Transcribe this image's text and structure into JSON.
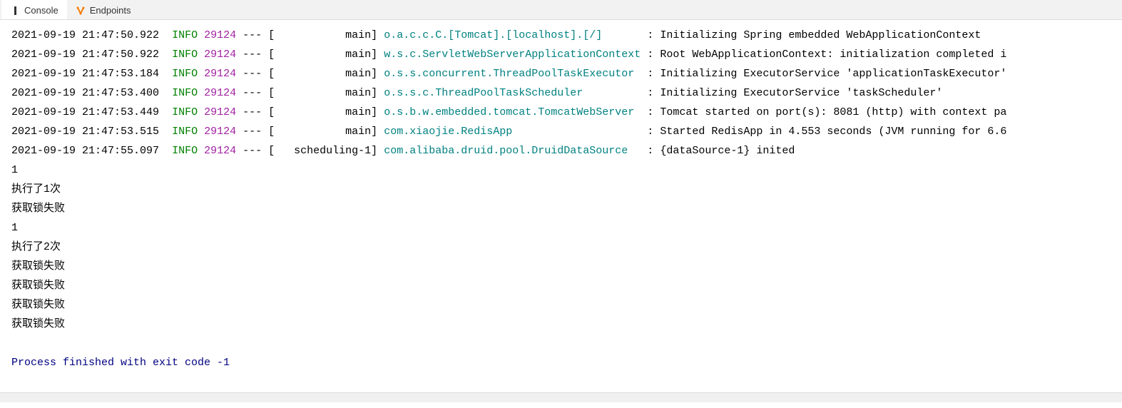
{
  "tabs": {
    "console": "Console",
    "endpoints": "Endpoints"
  },
  "lines": [
    {
      "type": "log",
      "timestamp": "2021-09-19 21:47:50.922",
      "level": "INFO",
      "pid": "29124",
      "dash": "---",
      "thread": "[           main]",
      "logger": "o.a.c.c.C.[Tomcat].[localhost].[/]      ",
      "message": "Initializing Spring embedded WebApplicationContext"
    },
    {
      "type": "log",
      "timestamp": "2021-09-19 21:47:50.922",
      "level": "INFO",
      "pid": "29124",
      "dash": "---",
      "thread": "[           main]",
      "logger": "w.s.c.ServletWebServerApplicationContext",
      "message": "Root WebApplicationContext: initialization completed i"
    },
    {
      "type": "log",
      "timestamp": "2021-09-19 21:47:53.184",
      "level": "INFO",
      "pid": "29124",
      "dash": "---",
      "thread": "[           main]",
      "logger": "o.s.s.concurrent.ThreadPoolTaskExecutor ",
      "message": "Initializing ExecutorService 'applicationTaskExecutor'"
    },
    {
      "type": "log",
      "timestamp": "2021-09-19 21:47:53.400",
      "level": "INFO",
      "pid": "29124",
      "dash": "---",
      "thread": "[           main]",
      "logger": "o.s.s.c.ThreadPoolTaskScheduler         ",
      "message": "Initializing ExecutorService 'taskScheduler'"
    },
    {
      "type": "log",
      "timestamp": "2021-09-19 21:47:53.449",
      "level": "INFO",
      "pid": "29124",
      "dash": "---",
      "thread": "[           main]",
      "logger": "o.s.b.w.embedded.tomcat.TomcatWebServer ",
      "message": "Tomcat started on port(s): 8081 (http) with context pa"
    },
    {
      "type": "log",
      "timestamp": "2021-09-19 21:47:53.515",
      "level": "INFO",
      "pid": "29124",
      "dash": "---",
      "thread": "[           main]",
      "logger": "com.xiaojie.RedisApp                    ",
      "message": "Started RedisApp in 4.553 seconds (JVM running for 6.6"
    },
    {
      "type": "log",
      "timestamp": "2021-09-19 21:47:55.097",
      "level": "INFO",
      "pid": "29124",
      "dash": "---",
      "thread": "[   scheduling-1]",
      "logger": "com.alibaba.druid.pool.DruidDataSource  ",
      "message": "{dataSource-1} inited"
    },
    {
      "type": "plain",
      "text": "1"
    },
    {
      "type": "plain",
      "text": "执行了1次"
    },
    {
      "type": "plain",
      "text": "获取锁失败"
    },
    {
      "type": "plain",
      "text": "1"
    },
    {
      "type": "plain",
      "text": "执行了2次"
    },
    {
      "type": "plain",
      "text": "获取锁失败"
    },
    {
      "type": "plain",
      "text": "获取锁失败"
    },
    {
      "type": "plain",
      "text": "获取锁失败"
    },
    {
      "type": "plain",
      "text": "获取锁失败"
    },
    {
      "type": "plain",
      "text": ""
    },
    {
      "type": "finish",
      "text": "Process finished with exit code -1"
    }
  ]
}
